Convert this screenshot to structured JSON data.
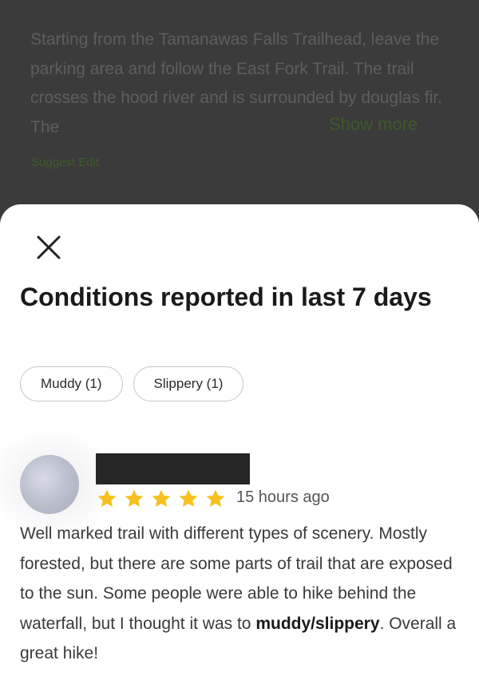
{
  "background_panel": {
    "description": "Starting from the Tamanawas Falls Trailhead, leave the parking area and follow the East Fork Trail. The trail crosses the hood river and is surrounded by douglas fir. The",
    "show_more_label": "Show more",
    "suggest_edit_label": "Suggest Edit"
  },
  "sheet": {
    "close_icon": "close-icon",
    "title": "Conditions reported in last 7 days",
    "chips": [
      {
        "label": "Muddy (1)"
      },
      {
        "label": "Slippery (1)"
      }
    ]
  },
  "review": {
    "rating": 5,
    "rating_max": 5,
    "time_ago": "15 hours ago",
    "text_before": "Well marked trail with different types of scenery. Mostly forested, but there are some parts of trail that are exposed to the sun. Some people were able to hike behind the waterfall, but I thought it was to ",
    "text_bold": "muddy/slippery",
    "text_after": ". Overall a great hike!"
  },
  "colors": {
    "star": "#F6C120",
    "accent_green": "#3E5A2A",
    "redaction": "#262626"
  }
}
